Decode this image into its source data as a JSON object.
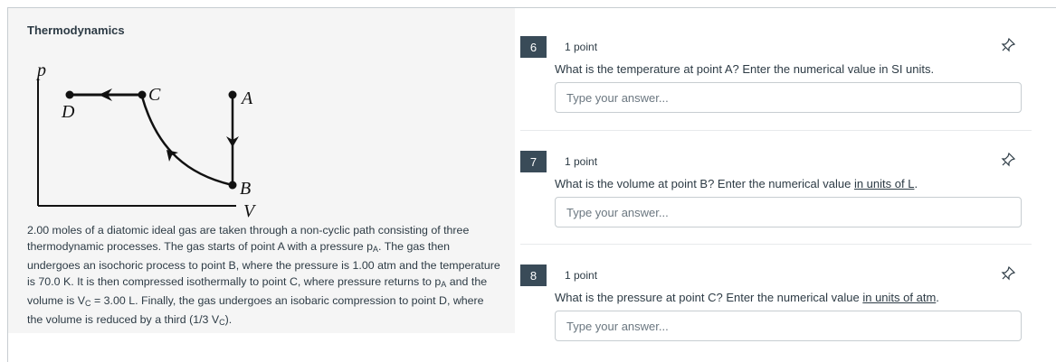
{
  "section": {
    "title": "Thermodynamics"
  },
  "diagram": {
    "axis_y": "p",
    "axis_x": "V",
    "points": {
      "A": "A",
      "B": "B",
      "C": "C",
      "D": "D"
    }
  },
  "problem": {
    "seg1": "2.00 moles of a diatomic ideal gas are taken through a non-cyclic path consisting of three thermodynamic processes. The gas starts of point A with a pressure p",
    "sub_a": "A",
    "seg2": ". The gas then undergoes an isochoric process to point B, where the pressure is 1.00 atm and the temperature is 70.0 K. It is then compressed isothermally to point C, where pressure returns to p",
    "sub_a2": "A",
    "seg3": " and the volume is V",
    "sub_c": "C",
    "seg4": " = 3.00 L. Finally, the gas undergoes an isobaric compression to point D, where the volume is reduced by a third (1/3 V",
    "sub_c2": "C",
    "seg5": ")."
  },
  "questions": [
    {
      "number": "6",
      "points": "1 point",
      "prompt_pre": "What is the temperature at point A? Enter the numerical value in SI units.",
      "prompt_link": "",
      "prompt_post": "",
      "placeholder": "Type your answer..."
    },
    {
      "number": "7",
      "points": "1 point",
      "prompt_pre": "What is the volume at point B? Enter the numerical value ",
      "prompt_link": "in units of L",
      "prompt_post": ".",
      "placeholder": "Type your answer..."
    },
    {
      "number": "8",
      "points": "1 point",
      "prompt_pre": "What is the pressure at point C? Enter the numerical value ",
      "prompt_link": "in units of atm",
      "prompt_post": ".",
      "placeholder": "Type your answer..."
    }
  ]
}
